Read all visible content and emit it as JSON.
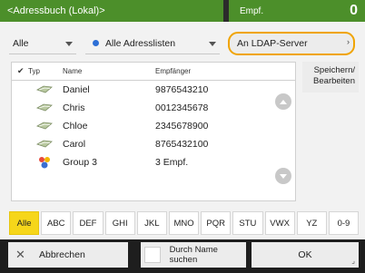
{
  "title": {
    "main": "<Adressbuch (Lokal)>",
    "count_label": "Empf.",
    "count_value": "0"
  },
  "filters": {
    "type_value": "Alle",
    "list_value": "Alle Adresslisten",
    "ldap_button": "An LDAP-Server"
  },
  "list": {
    "headers": {
      "check": "✔",
      "type": "Typ",
      "name": "Name",
      "recipient": "Empfänger"
    },
    "rows": [
      {
        "icon": "address-icon",
        "name": "Daniel",
        "recipient": "9876543210"
      },
      {
        "icon": "address-icon",
        "name": "Chris",
        "recipient": "0012345678"
      },
      {
        "icon": "address-icon",
        "name": "Chloe",
        "recipient": "2345678900"
      },
      {
        "icon": "address-icon",
        "name": "Carol",
        "recipient": "8765432100"
      },
      {
        "icon": "group-icon",
        "name": "Group 3",
        "recipient": "3 Empf."
      }
    ]
  },
  "side": {
    "save_edit": "Speichern/ Bearbeiten"
  },
  "alphabet": [
    "Alle",
    "ABC",
    "DEF",
    "GHI",
    "JKL",
    "MNO",
    "PQR",
    "STU",
    "VWX",
    "YZ",
    "0-9"
  ],
  "alphabet_active": "Alle",
  "footer": {
    "cancel": "Abbrechen",
    "search_by_name": "Durch Name suchen",
    "ok": "OK"
  },
  "colors": {
    "accent_green": "#4c8f2a",
    "highlight_yellow": "#f6d61a",
    "ldap_border": "#f0a400",
    "selected_dot": "#2d6fd6"
  }
}
